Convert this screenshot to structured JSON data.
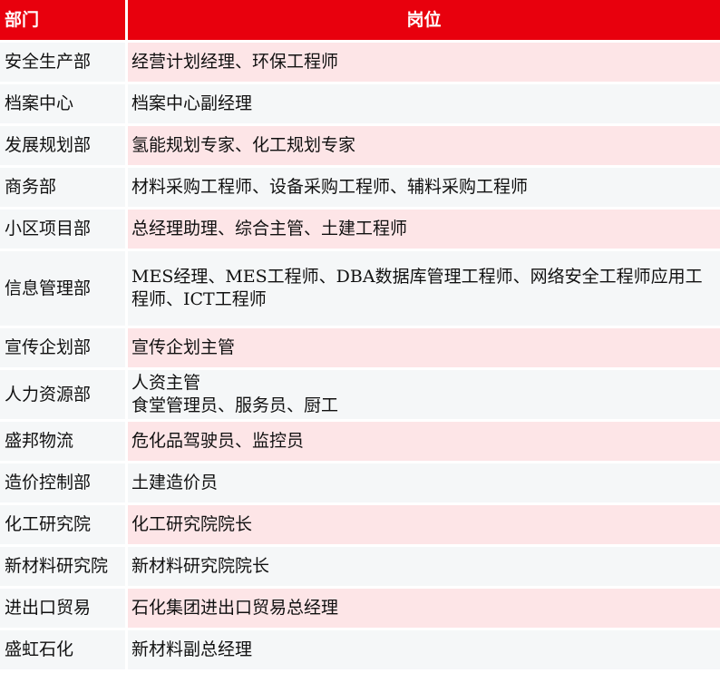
{
  "header": {
    "department": "部门",
    "position": "岗位"
  },
  "rows": [
    {
      "department": "安全生产部",
      "position": "经营计划经理、环保工程师"
    },
    {
      "department": "档案中心",
      "position": "档案中心副经理"
    },
    {
      "department": "发展规划部",
      "position": "氢能规划专家、化工规划专家"
    },
    {
      "department": "商务部",
      "position": "材料采购工程师、设备采购工程师、辅料采购工程师"
    },
    {
      "department": "小区项目部",
      "position": "总经理助理、综合主管、土建工程师"
    },
    {
      "department": "信息管理部",
      "position": "MES经理、MES工程师、DBA数据库管理工程师、网络安全工程师应用工程师、ICT工程师"
    },
    {
      "department": "宣传企划部",
      "position": "宣传企划主管"
    },
    {
      "department": "人力资源部",
      "position_lines": [
        "人资主管",
        "食堂管理员、服务员、厨工"
      ]
    },
    {
      "department": "盛邦物流",
      "position": "危化品驾驶员、监控员"
    },
    {
      "department": "造价控制部",
      "position": "土建造价员"
    },
    {
      "department": "化工研究院",
      "position": "化工研究院院长"
    },
    {
      "department": "新材料研究院",
      "position": "新材料研究院院长"
    },
    {
      "department": "进出口贸易",
      "position": "石化集团进出口贸易总经理"
    },
    {
      "department": "盛虹石化",
      "position": "新材料副总经理"
    }
  ]
}
